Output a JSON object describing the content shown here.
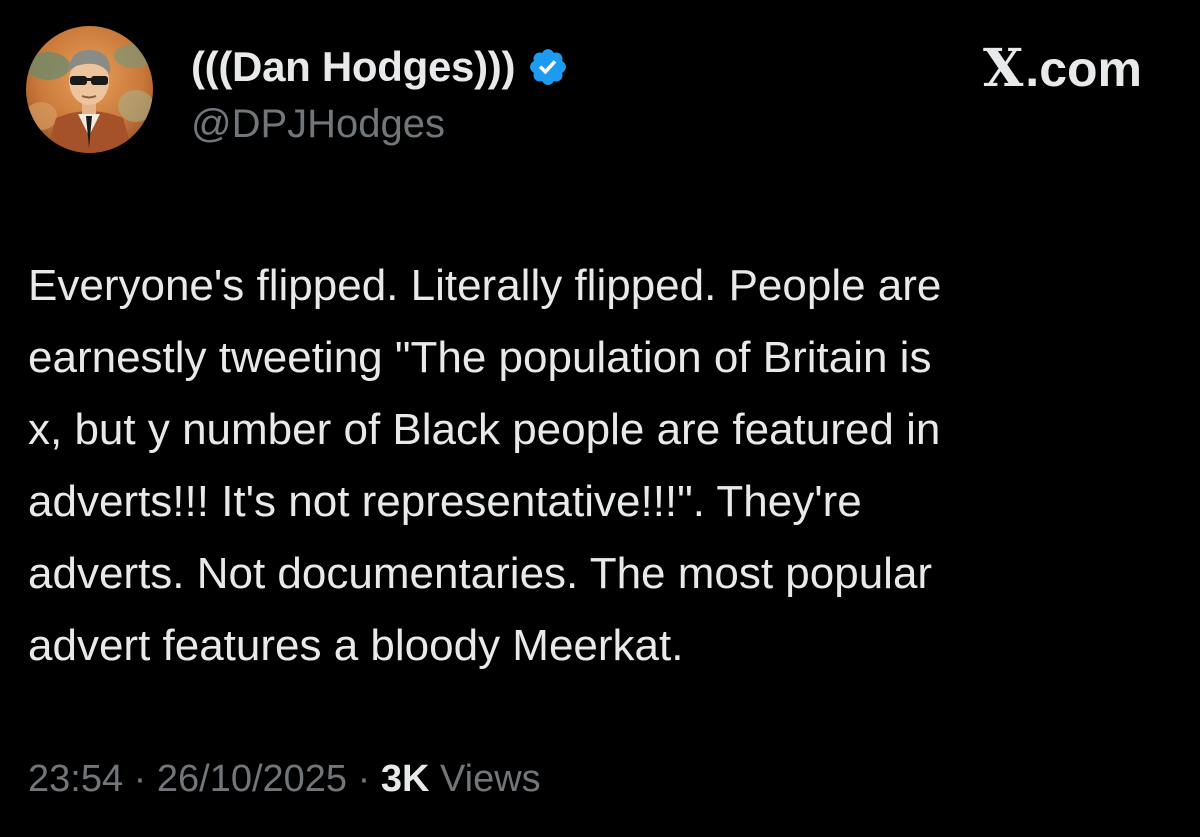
{
  "author": {
    "display_name": "(((Dan Hodges)))",
    "handle": "@DPJHodges",
    "verified": true,
    "verified_color": "#1d9bf0"
  },
  "site_mark": {
    "glyph": "X",
    "text": ".com"
  },
  "tweet": {
    "lines": [
      "Everyone's flipped. Literally flipped. People are",
      "earnestly tweeting \"The population of Britain is",
      "x, but y number of Black people are featured in",
      "adverts!!! It's not representative!!!\". They're",
      "adverts. Not documentaries. The most popular",
      "advert features a bloody Meerkat."
    ]
  },
  "meta": {
    "time": "23:54",
    "separator": " · ",
    "date": "26/10/2025",
    "views_count": "3K",
    "views_label": " Views"
  },
  "colors": {
    "background": "#000000",
    "primary_text": "#e7e9ea",
    "secondary_text": "#71767b",
    "accent": "#1d9bf0"
  }
}
